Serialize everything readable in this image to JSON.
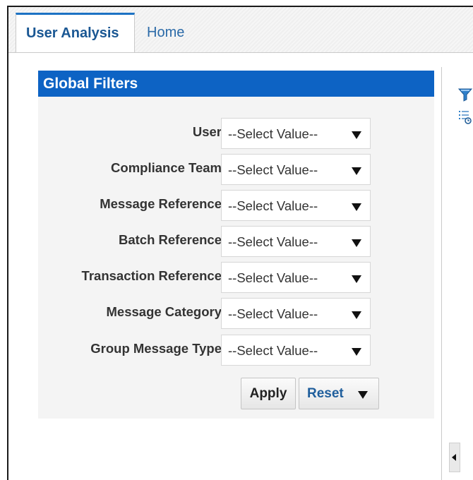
{
  "tabs": [
    {
      "label": "User Analysis",
      "active": true
    },
    {
      "label": "Home",
      "active": false
    }
  ],
  "panel": {
    "title": "Global Filters",
    "header_color": "#0d63c4"
  },
  "filters": [
    {
      "label": "User",
      "value": "--Select Value--"
    },
    {
      "label": "Compliance Team",
      "value": "--Select Value--"
    },
    {
      "label": "Message Reference",
      "value": "--Select Value--"
    },
    {
      "label": "Batch Reference",
      "value": "--Select Value--"
    },
    {
      "label": "Transaction Reference",
      "value": "--Select Value--"
    },
    {
      "label": "Message Category",
      "value": "--Select Value--"
    },
    {
      "label": "Group Message Type",
      "value": "--Select Value--"
    }
  ],
  "buttons": {
    "apply_label": "Apply",
    "reset_label": "Reset"
  },
  "side_icons": [
    "filter-icon",
    "prompt-list-icon"
  ],
  "colors": {
    "accent": "#1c72c4",
    "link": "#1f5e9c"
  }
}
